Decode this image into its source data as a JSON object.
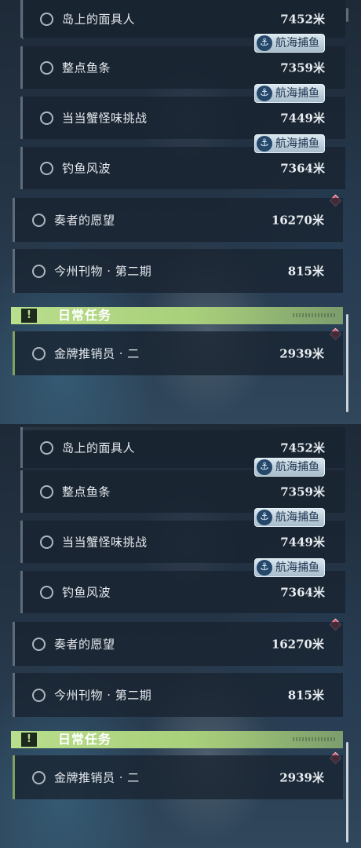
{
  "quests": [
    {
      "label": "岛上的面具人",
      "distance": "7452米"
    },
    {
      "label": "整点鱼条",
      "distance": "7359米",
      "badge": "航海捕鱼"
    },
    {
      "label": "当当蟹怪味挑战",
      "distance": "7449米",
      "badge": "航海捕鱼"
    },
    {
      "label": "钓鱼风波",
      "distance": "7364米",
      "badge": "航海捕鱼"
    },
    {
      "label": "奏者的愿望",
      "distance": "16270米"
    },
    {
      "label": "今州刊物 · 第二期",
      "distance": "815米"
    }
  ],
  "section": {
    "title": "日常任务",
    "icon": "!"
  },
  "daily": [
    {
      "label": "金牌推销员 · 二",
      "distance": "2939米"
    }
  ],
  "icons": {
    "badge_icon": "anchor-icon",
    "quest_icon": "circle-icon",
    "alert_icon": "diamond-icon"
  },
  "colors": {
    "section_green": "#b9de8c",
    "badge_bg": "#d9e6ee",
    "alert_red": "#d9465a"
  }
}
